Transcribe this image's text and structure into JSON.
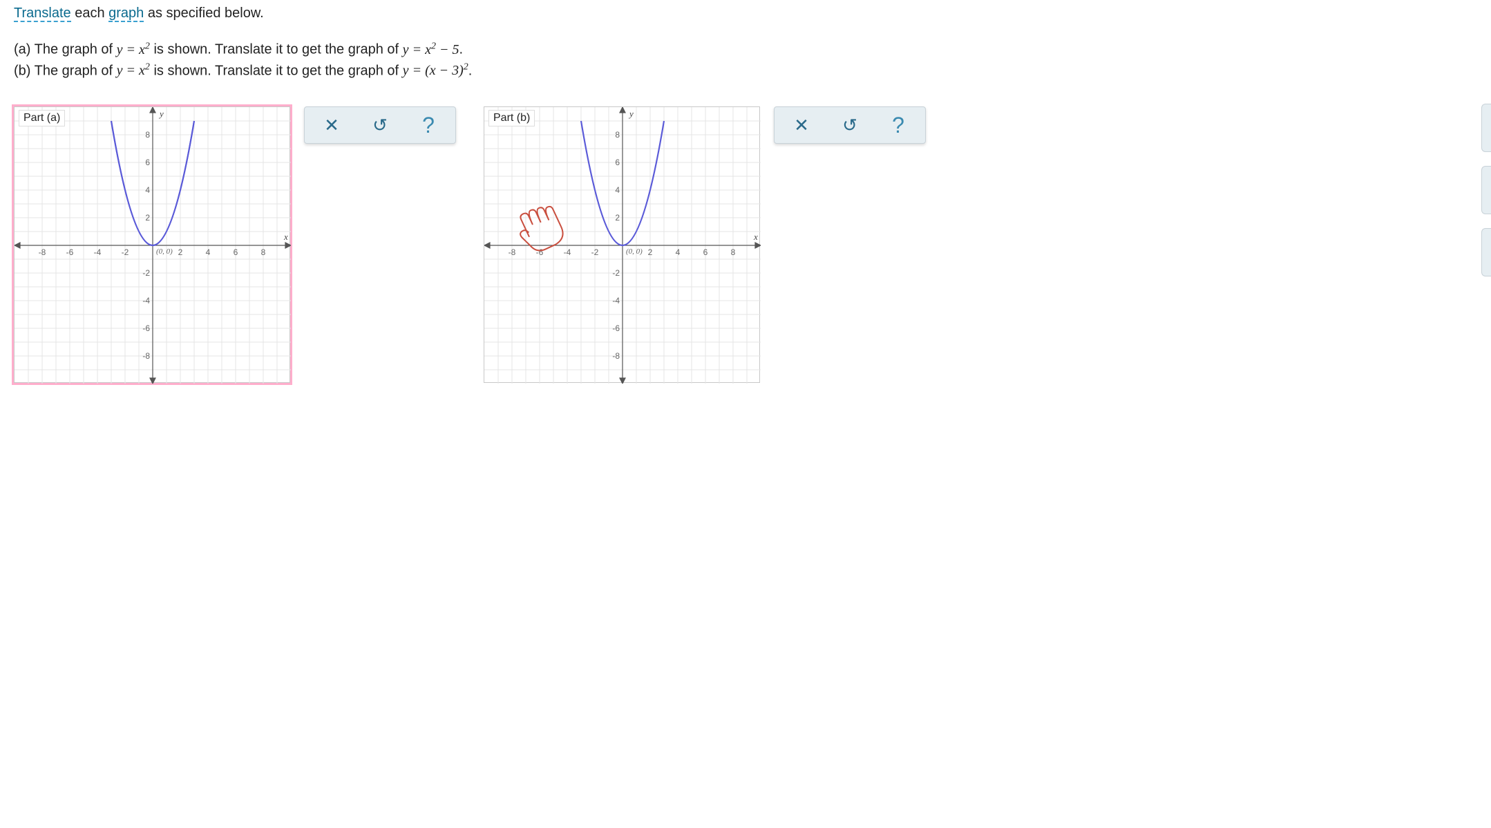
{
  "instruction": {
    "word_translate": "Translate",
    "mid": " each ",
    "word_graph": "graph",
    "tail": " as specified below."
  },
  "prompt_a": {
    "prefix": "(a) The graph of ",
    "eq1_lhs": "y",
    "eq1_rhs_base": "x",
    "eq1_rhs_exp": "2",
    "mid": " is shown. Translate it to get the graph of ",
    "eq2_lhs": "y",
    "eq2_rhs_base": "x",
    "eq2_rhs_exp": "2",
    "eq2_rhs_tail": " − 5",
    "period": "."
  },
  "prompt_b": {
    "prefix": "(b) The graph of ",
    "eq1_lhs": "y",
    "eq1_rhs_base": "x",
    "eq1_rhs_exp": "2",
    "mid": " is shown. Translate it to get the graph of ",
    "eq2_lhs": "y",
    "eq2_rhs_inner": "(x − 3)",
    "eq2_rhs_exp": "2",
    "period": "."
  },
  "parts": {
    "a": {
      "legend": "Part (a)",
      "origin": "(0, 0)"
    },
    "b": {
      "legend": "Part (b)",
      "origin": "(0, 0)"
    }
  },
  "axis": {
    "ticks_pos": [
      "2",
      "4",
      "6",
      "8"
    ],
    "ticks_neg": [
      "-2",
      "-4",
      "-6",
      "-8"
    ],
    "x_name": "x",
    "y_name": "y"
  },
  "tools": {
    "clear": "✕",
    "undo": "↺",
    "help": "?"
  },
  "chart_data": [
    {
      "type": "line",
      "title": "Part (a)",
      "xlabel": "x",
      "ylabel": "y",
      "xlim": [
        -9,
        9
      ],
      "ylim": [
        -9,
        9
      ],
      "series": [
        {
          "name": "y = x^2",
          "x": [
            -3,
            -2.5,
            -2,
            -1.5,
            -1,
            -0.5,
            0,
            0.5,
            1,
            1.5,
            2,
            2.5,
            3
          ],
          "y": [
            9,
            6.25,
            4,
            2.25,
            1,
            0.25,
            0,
            0.25,
            1,
            2.25,
            4,
            6.25,
            9
          ],
          "vertex": [
            0,
            0
          ],
          "color": "#5a5ad8"
        }
      ]
    },
    {
      "type": "line",
      "title": "Part (b)",
      "xlabel": "x",
      "ylabel": "y",
      "xlim": [
        -9,
        9
      ],
      "ylim": [
        -9,
        9
      ],
      "series": [
        {
          "name": "y = x^2",
          "x": [
            -3,
            -2.5,
            -2,
            -1.5,
            -1,
            -0.5,
            0,
            0.5,
            1,
            1.5,
            2,
            2.5,
            3
          ],
          "y": [
            9,
            6.25,
            4,
            2.25,
            1,
            0.25,
            0,
            0.25,
            1,
            2.25,
            4,
            6.25,
            9
          ],
          "vertex": [
            0,
            0
          ],
          "color": "#5a5ad8"
        }
      ]
    }
  ]
}
